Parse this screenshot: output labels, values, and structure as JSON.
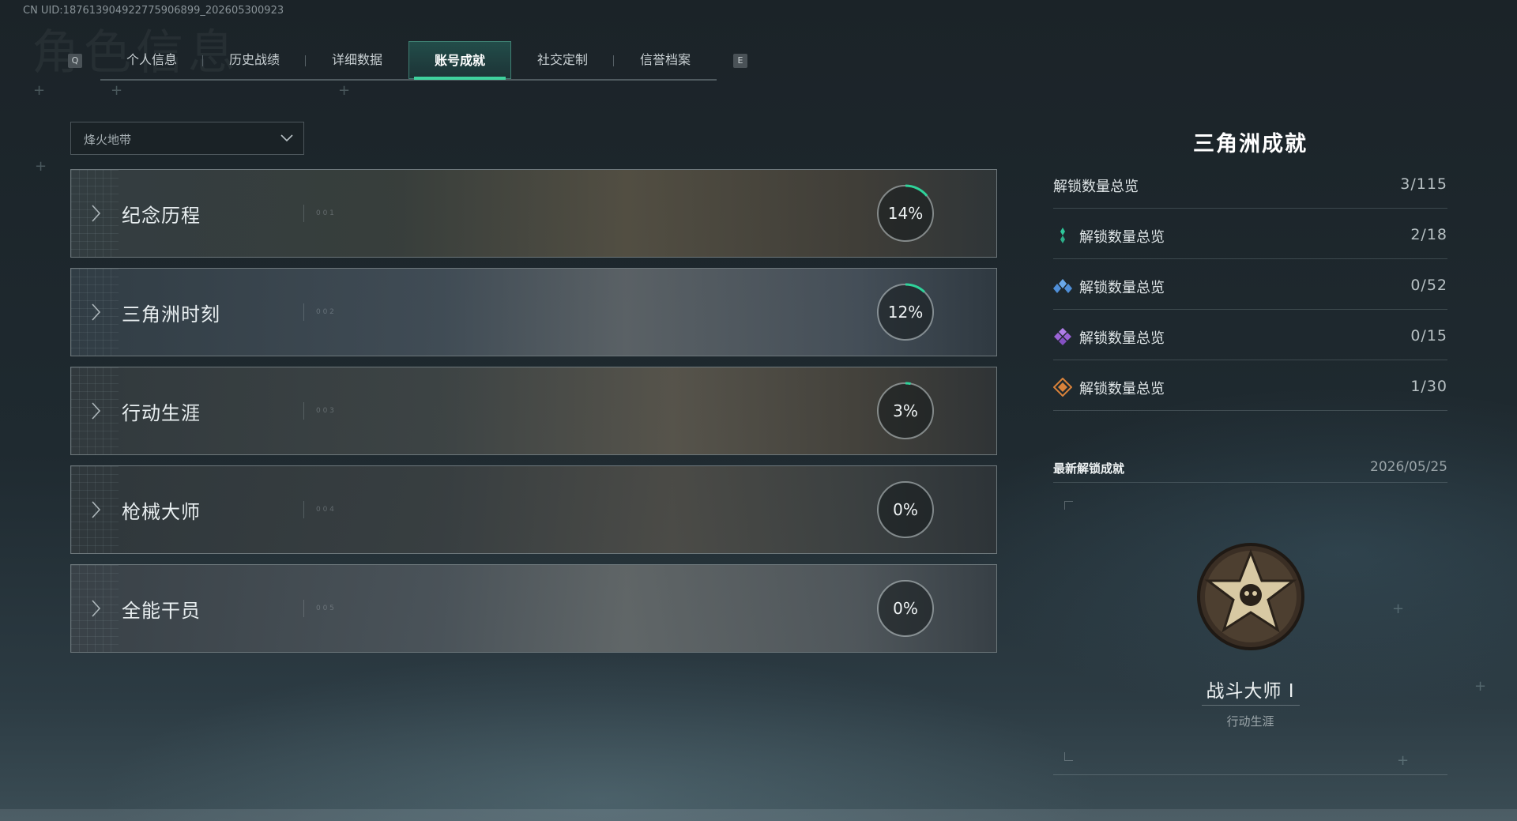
{
  "uid_text": "CN UID:187613904922775906899_202605300923",
  "tabs": {
    "left_key": "Q",
    "right_key": "E",
    "items": [
      {
        "label": "个人信息",
        "active": false
      },
      {
        "label": "历史战绩",
        "active": false
      },
      {
        "label": "详细数据",
        "active": false
      },
      {
        "label": "账号成就",
        "active": true
      },
      {
        "label": "社交定制",
        "active": false
      },
      {
        "label": "信誉档案",
        "active": false
      }
    ]
  },
  "mode_select": {
    "value": "烽火地带"
  },
  "categories": [
    {
      "title": "纪念历程",
      "code": "0 0 1",
      "percent": 14,
      "percent_label": "14%"
    },
    {
      "title": "三角洲时刻",
      "code": "0 0 2",
      "percent": 12,
      "percent_label": "12%"
    },
    {
      "title": "行动生涯",
      "code": "0 0 3",
      "percent": 3,
      "percent_label": "3%"
    },
    {
      "title": "枪械大师",
      "code": "0 0 4",
      "percent": 0,
      "percent_label": "0%"
    },
    {
      "title": "全能干员",
      "code": "0 0 5",
      "percent": 0,
      "percent_label": "0%"
    }
  ],
  "summary": {
    "title": "三角洲成就",
    "total": {
      "label": "解锁数量总览",
      "value": "3/115"
    },
    "tiers": [
      {
        "label": "解锁数量总览",
        "value": "2/18",
        "icon": "green-gem-icon",
        "color": "#2fc79a"
      },
      {
        "label": "解锁数量总览",
        "value": "0/52",
        "icon": "blue-gem-icon",
        "color": "#4f8fd8"
      },
      {
        "label": "解锁数量总览",
        "value": "0/15",
        "icon": "purple-gem-icon",
        "color": "#9b63d6"
      },
      {
        "label": "解锁数量总览",
        "value": "1/30",
        "icon": "orange-gem-icon",
        "color": "#d9823a"
      }
    ]
  },
  "recent": {
    "label": "最新解锁成就",
    "date": "2026/05/25",
    "achievement_name": "战斗大师 I",
    "achievement_category": "行动生涯"
  },
  "colors": {
    "accent": "#3fd19d",
    "progress": "#2fd39a"
  }
}
